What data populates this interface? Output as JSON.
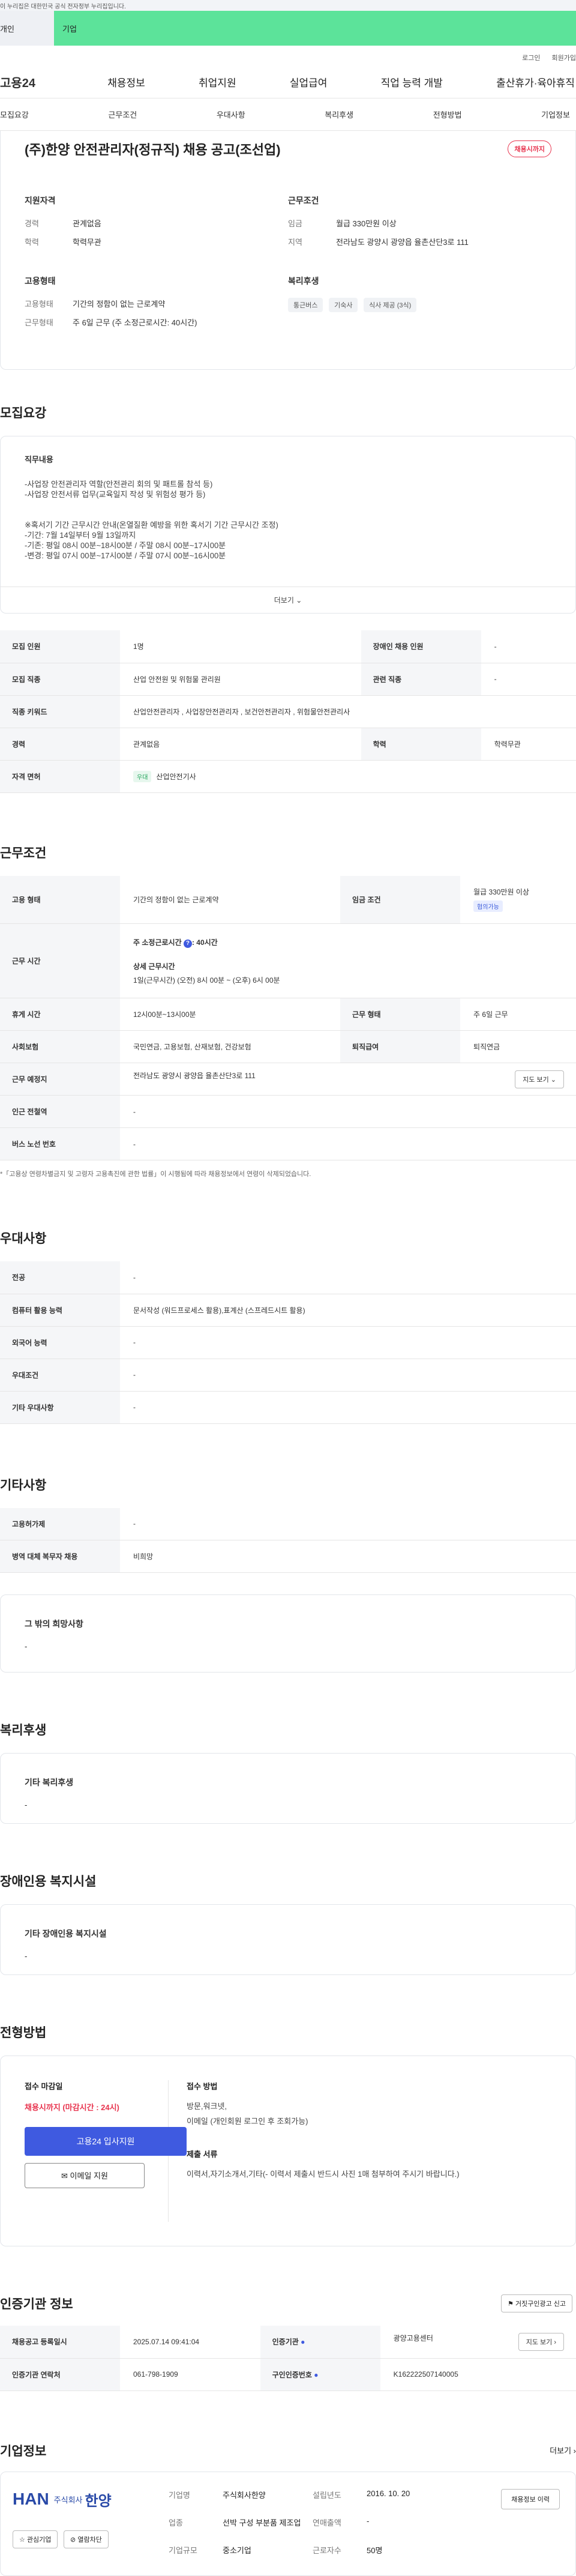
{
  "gov_banner": "이 누리집은 대한민국 공식 전자정부 누리집입니다.",
  "tabs": {
    "personal": "개인",
    "company": "기업"
  },
  "util": {
    "login": "로그인",
    "join": "회원가입"
  },
  "gnb": {
    "logo": "고용24",
    "items": [
      "채용정보",
      "취업지원",
      "실업급여",
      "직업 능력 개발",
      "출산휴가·육아휴직"
    ]
  },
  "subnav": [
    "모집요강",
    "근무조건",
    "우대사항",
    "복리후생",
    "전형방법",
    "기업정보"
  ],
  "job": {
    "title": "(주)한양 안전관리자(정규직) 채용 공고(조선업)",
    "badge": "채용시까지"
  },
  "summary": {
    "qual_h": "지원자격",
    "career_k": "경력",
    "career_v": "관계없음",
    "edu_k": "학력",
    "edu_v": "학력무관",
    "cond_h": "근무조건",
    "wage_k": "임금",
    "wage_v": "월급 330만원 이상",
    "area_k": "지역",
    "area_v": "전라남도 광양시 광양읍 율촌산단3로 111",
    "emp_h": "고용형태",
    "emptype_k": "고용형태",
    "emptype_v": "기간의 정함이 없는 근로계약",
    "worktype_k": "근무형태",
    "worktype_v": "주 6일 근무 (주 소정근로시간: 40시간)",
    "welfare_h": "복리후생",
    "welfare_chips": [
      "통근버스",
      "기숙사",
      "식사 제공 (3식)"
    ]
  },
  "recruit": {
    "title": "모집요강",
    "desc_h": "직무내용",
    "lines": [
      "-사업장 안전관리자 역할(안전관리 회의 및 패트롤 참석 등)",
      "-사업장 안전서류 업무(교육일지 작성 및 위험성 평가 등)",
      "",
      "",
      "※혹서기 기간 근무시간 안내(온열질환 예방을 위한 혹서기 기간 근무시간 조정)",
      "-기간: 7월 14일부터 9월 13일까지",
      "-기존: 평일 08시 00분~18시00분 / 주말 08시 00분~17시00분",
      "-변경: 평일 07시 00분~17시00분 / 주말 07시 00분~16시00분"
    ],
    "more": "더보기",
    "rows": [
      [
        "모집 인원",
        "1명",
        "장애인 채용 인원",
        "-"
      ],
      [
        "모집 직종",
        "산업 안전원 및 위험물 관리원",
        "관련 직종",
        "-"
      ]
    ],
    "keyword_k": "직종 키워드",
    "keyword_v": "산업안전관리자 , 사업장안전관리자 , 보건안전관리자 , 위험물안전관리사",
    "career_k": "경력",
    "career_v": "관계없음",
    "edu_k": "학력",
    "edu_v": "학력무관",
    "license_k": "자격 면허",
    "license_tag": "우대",
    "license_v": "산업안전기사"
  },
  "work": {
    "title": "근무조건",
    "emp_k": "고용 형태",
    "emp_v": "기간의 정함이 없는 근로계약",
    "wage_k": "임금 조건",
    "wage_v": "월급 330만원 이상",
    "wage_tag": "협의가능",
    "hours_k": "근무 시간",
    "hours_week": "주 소정근로시간",
    "hours_week_v": ": 40시간",
    "hours_detail_h": "상세 근무시간",
    "hours_detail_v": "1일(근무시간) (오전) 8시 00분 ~ (오후) 6시 00분",
    "rest_k": "휴게 시간",
    "rest_v": "12시00분~13시00분",
    "form_k": "근무 형태",
    "form_v": "주 6일 근무",
    "ins_k": "사회보험",
    "ins_v": "국민연금, 고용보험, 산재보험, 건강보험",
    "ret_k": "퇴직급여",
    "ret_v": "퇴직연금",
    "place_k": "근무 예정지",
    "place_v": "전라남도 광양시 광양읍 율촌산단3로 111",
    "map": "지도 보기",
    "sub_k": "인근 전철역",
    "sub_v": "-",
    "bus_k": "버스 노선 번호",
    "bus_v": "-",
    "note": "*「고용상 연령차별금지 및 고령자 고용촉진에 관한 법률」이 시행됨에 따라 채용정보에서 연령이 삭제되었습니다."
  },
  "pref": {
    "title": "우대사항",
    "rows": [
      [
        "전공",
        "-"
      ],
      [
        "컴퓨터 활용 능력",
        "문서작성 (워드프로세스 활용),표계산 (스프레드시트 활용)"
      ],
      [
        "외국어 능력",
        "-"
      ],
      [
        "우대조건",
        "-"
      ],
      [
        "기타 우대사항",
        "-"
      ]
    ]
  },
  "etc": {
    "title": "기타사항",
    "rows": [
      [
        "고용허가제",
        "-"
      ],
      [
        "병역 대체 복무자 채용",
        "비희망"
      ]
    ],
    "other_h": "그 밖의 희망사항",
    "other_v": "-"
  },
  "welfare": {
    "title": "복리후생",
    "h": "기타 복리후생",
    "v": "-"
  },
  "disab": {
    "title": "장애인용 복지시설",
    "h": "기타 장애인용 복지시설",
    "v": "-"
  },
  "process": {
    "title": "전형방법",
    "deadline_h": "접수 마감일",
    "deadline_v": "채용시까지 (마감시간 : 24시)",
    "apply_btn": "고용24 입사지원",
    "email_btn": "이메일 지원",
    "method_h": "접수 방법",
    "method_v1": "방문,워크넷,",
    "method_v2": "이메일 (개인회원 로그인 후 조회가능)",
    "docs_h": "제출 서류",
    "docs_v": "이력서,자기소개서,기타(- 이력서 제출시 반드시 사진 1매 첨부하여 주시기 바랍니다.)"
  },
  "cert": {
    "title": "인증기관 정보",
    "report": "거짓구인광고 신고",
    "rows": [
      [
        "채용공고 등록일시",
        "2025.07.14 09:41:04",
        "인증기관",
        "광양고용센터"
      ],
      [
        "인증기관 연락처",
        "061-798-1909",
        "구인인증번호",
        "K162222507140005"
      ]
    ],
    "map": "지도 보기"
  },
  "company": {
    "title": "기업정보",
    "more": "더보기",
    "logo_han": "HAN",
    "logo_sub": "주식회사",
    "logo_name": "한양",
    "fav": "관심기업",
    "block": "열람차단",
    "k1": "기업명",
    "v1": "주식회사한양",
    "k2": "업종",
    "v2": "선박 구성 부분품 제조업",
    "k3": "기업규모",
    "v3": "중소기업",
    "k4": "설립년도",
    "v4": "2016. 10. 20",
    "k5": "연매출액",
    "v5": "-",
    "k6": "근로자수",
    "v6": "50명",
    "history": "채용정보 이력"
  },
  "colors": {
    "accent": "#3f5ae0",
    "company_tab": "#5ce39a",
    "badge": "#e8344e"
  }
}
